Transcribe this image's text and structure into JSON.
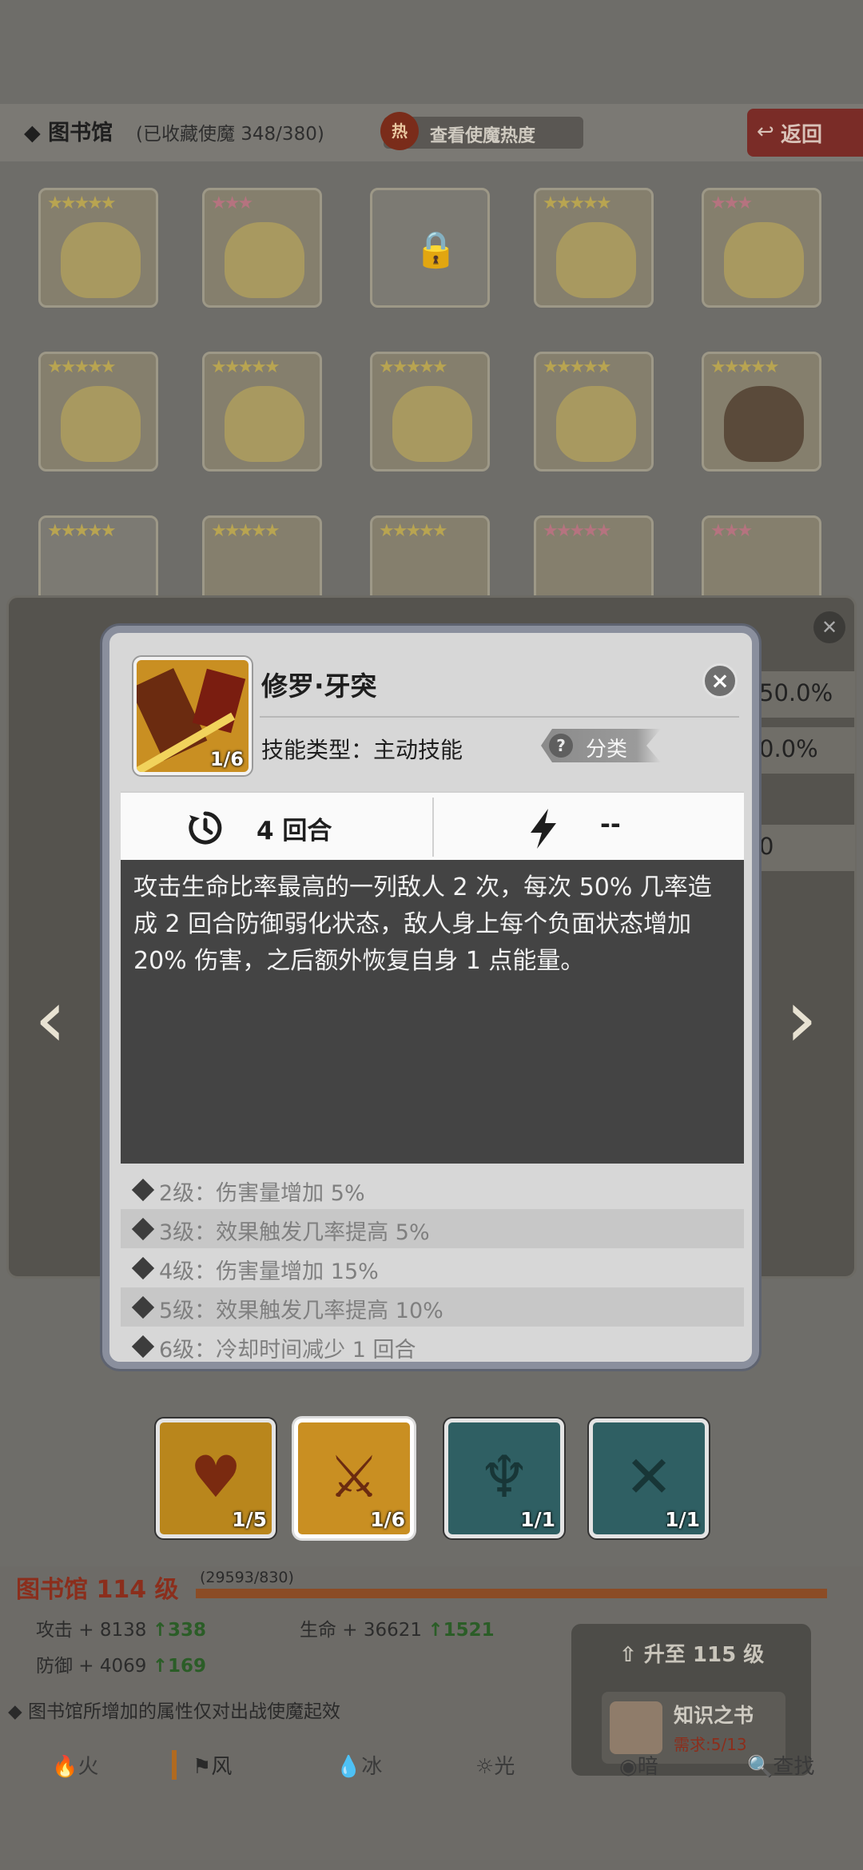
{
  "header": {
    "title": "图书馆",
    "collection": "(已收藏使魔 348/380)",
    "hot_icon": "热",
    "hot_button": "查看使魔热度",
    "back_button": "返回"
  },
  "popup": {
    "skill_name": "修罗·牙突",
    "skill_icon_count": "1/6",
    "skill_type": "技能类型：主动技能",
    "category_label": "分类",
    "cooldown": "4 回合",
    "energy": "--",
    "description": "攻击生命比率最高的一列敌人 2 次，每次 50% 几率造成 2 回合防御弱化状态，敌人身上每个负面状态增加 20% 伤害，之后额外恢复自身 1 点能量。",
    "levels": [
      "2级：伤害量增加 5%",
      "3级：效果触发几率提高 5%",
      "4级：伤害量增加 15%",
      "5级：效果触发几率提高 10%",
      "6级：冷却时间减少 1 回合"
    ]
  },
  "side_panel": {
    "values": [
      "50.0%",
      "0.0%",
      "0"
    ]
  },
  "skill_slots": [
    {
      "count": "1/5",
      "icon": "heart-swords-icon",
      "color": "#c08a1e"
    },
    {
      "count": "1/6",
      "icon": "warrior-icon",
      "color": "#c98f22"
    },
    {
      "count": "1/1",
      "icon": "winged-demon-icon",
      "color": "#2f5f63"
    },
    {
      "count": "1/1",
      "icon": "crossed-swords-icon",
      "color": "#2f5f63"
    }
  ],
  "library": {
    "level": "图书馆 114 级",
    "exp": "(29593/830)",
    "attack_label": "攻击 + 8138",
    "attack_up": "338",
    "hp_label": "生命 + 36621",
    "hp_up": "1521",
    "defense_label": "防御 + 4069",
    "defense_up": "169",
    "notice": "图书馆所增加的属性仅对出战使魔起效",
    "upgrade_label": "升至 115 级",
    "book_name": "知识之书",
    "book_need": "需求:5/13"
  },
  "tabs": [
    "火",
    "风",
    "冰",
    "光",
    "暗",
    "查找"
  ]
}
